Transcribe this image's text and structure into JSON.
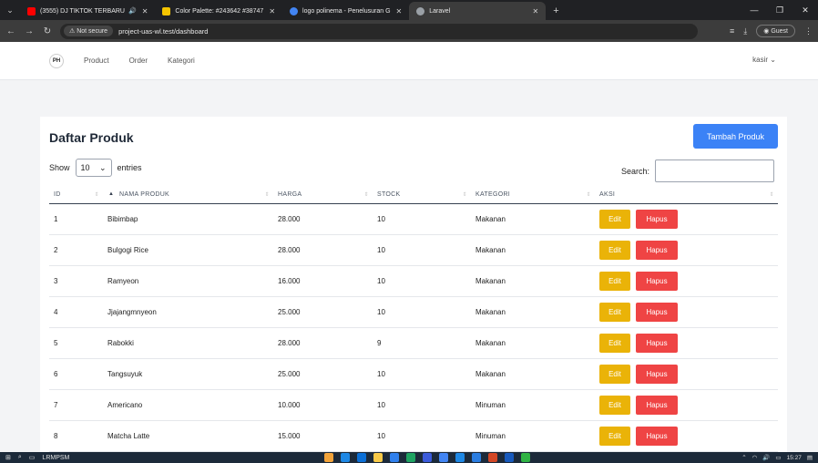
{
  "browser": {
    "tabs": [
      {
        "label": "(3555) DJ TIKTOK TERBARU",
        "favicon_color": "#ff0000",
        "active": false
      },
      {
        "label": "Color Palette: #243642 #38747",
        "favicon_color": "#f5c400",
        "active": false
      },
      {
        "label": "logo polinema - Penelusuran G",
        "favicon_color": "#4285f4",
        "active": false
      },
      {
        "label": "Laravel",
        "favicon_color": "#9aa0a6",
        "active": true
      }
    ],
    "new_tab": "+",
    "not_secure": "⚠ Not secure",
    "url": "project-uas-wl.test/dashboard",
    "guest": "Guest"
  },
  "app_nav": {
    "logo_text": "PH",
    "links": [
      "Product",
      "Order",
      "Kategori"
    ],
    "user": "kasir ⌄"
  },
  "main": {
    "title": "Daftar Produk",
    "add_button": "Tambah Produk",
    "show_label": "Show",
    "entries_value": "10",
    "entries_label": "entries",
    "search_label": "Search:"
  },
  "table": {
    "columns": [
      "ID",
      "NAMA PRODUK",
      "HARGA",
      "STOCK",
      "KATEGORI",
      "AKSI"
    ],
    "edit_label": "Edit",
    "delete_label": "Hapus",
    "rows": [
      {
        "id": "1",
        "name": "Bibimbap",
        "price": "28.000",
        "stock": "10",
        "category": "Makanan"
      },
      {
        "id": "2",
        "name": "Bulgogi Rice",
        "price": "28.000",
        "stock": "10",
        "category": "Makanan"
      },
      {
        "id": "3",
        "name": "Ramyeon",
        "price": "16.000",
        "stock": "10",
        "category": "Makanan"
      },
      {
        "id": "4",
        "name": "Jjajangmnyeon",
        "price": "25.000",
        "stock": "10",
        "category": "Makanan"
      },
      {
        "id": "5",
        "name": "Rabokki",
        "price": "28.000",
        "stock": "9",
        "category": "Makanan"
      },
      {
        "id": "6",
        "name": "Tangsuyuk",
        "price": "25.000",
        "stock": "10",
        "category": "Makanan"
      },
      {
        "id": "7",
        "name": "Americano",
        "price": "10.000",
        "stock": "10",
        "category": "Minuman"
      },
      {
        "id": "8",
        "name": "Matcha Latte",
        "price": "15.000",
        "stock": "10",
        "category": "Minuman"
      }
    ]
  },
  "taskbar": {
    "search_text": "LRMPSM",
    "time": "15:27"
  },
  "colors": {
    "primary": "#3b82f6",
    "edit": "#eab308",
    "delete": "#ef4444"
  }
}
